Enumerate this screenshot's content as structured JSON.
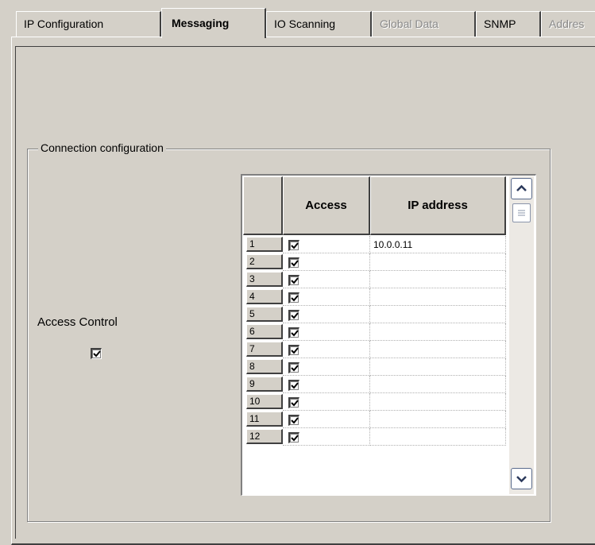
{
  "tabs": [
    {
      "label": "IP Configuration",
      "state": "normal"
    },
    {
      "label": "Messaging",
      "state": "active"
    },
    {
      "label": "IO Scanning",
      "state": "normal"
    },
    {
      "label": "Global Data",
      "state": "disabled"
    },
    {
      "label": "SNMP",
      "state": "normal"
    },
    {
      "label": "Addres",
      "state": "disabled"
    }
  ],
  "connection": {
    "group_title": "Connection configuration",
    "access_control_label": "Access Control",
    "access_control_checked": true
  },
  "grid": {
    "columns": [
      "",
      "Access",
      "IP address"
    ],
    "rows": [
      {
        "num": "1",
        "access": true,
        "ip": "10.0.0.11"
      },
      {
        "num": "2",
        "access": true,
        "ip": ""
      },
      {
        "num": "3",
        "access": true,
        "ip": ""
      },
      {
        "num": "4",
        "access": true,
        "ip": ""
      },
      {
        "num": "5",
        "access": true,
        "ip": ""
      },
      {
        "num": "6",
        "access": true,
        "ip": ""
      },
      {
        "num": "7",
        "access": true,
        "ip": ""
      },
      {
        "num": "8",
        "access": true,
        "ip": ""
      },
      {
        "num": "9",
        "access": true,
        "ip": ""
      },
      {
        "num": "10",
        "access": true,
        "ip": ""
      },
      {
        "num": "11",
        "access": true,
        "ip": ""
      },
      {
        "num": "12",
        "access": true,
        "ip": ""
      }
    ]
  }
}
